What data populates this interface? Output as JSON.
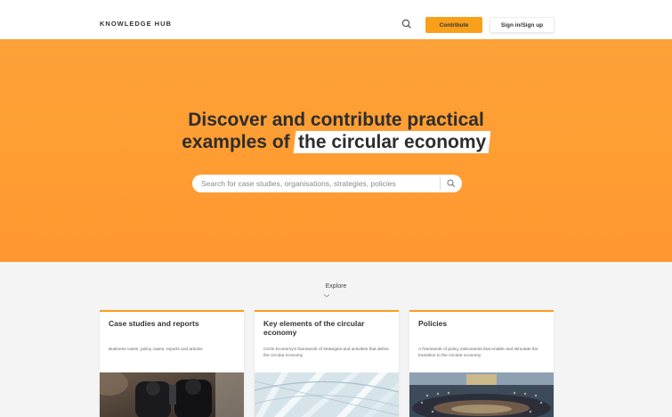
{
  "header": {
    "logo": "KNOWLEDGE HUB",
    "search_icon": "search-icon",
    "contribute_label": "Contribute",
    "signin_label": "Sign in/Sign up"
  },
  "hero": {
    "title_line1": "Discover and contribute practical",
    "title_line2_prefix": "examples of",
    "title_highlight": "the circular economy",
    "search_placeholder": "Search for case studies, organisations, strategies, policies",
    "search_submit_icon": "search-icon"
  },
  "explore": {
    "label": "Explore",
    "icon": "chevron-down-icon"
  },
  "cards": [
    {
      "title": "Case studies and reports",
      "description": "Business cases, policy cases, reports and articles"
    },
    {
      "title": "Key elements of the circular economy",
      "description": "Circle Economy's framework of strategies and activities that define the circular economy"
    },
    {
      "title": "Policies",
      "description": "A framework of policy instruments that enable and stimulate the transition to the circular economy"
    }
  ],
  "colors": {
    "accent": "#f9a01b",
    "hero_bg": "#ff9e33",
    "page_bg": "#f4f4f4"
  }
}
